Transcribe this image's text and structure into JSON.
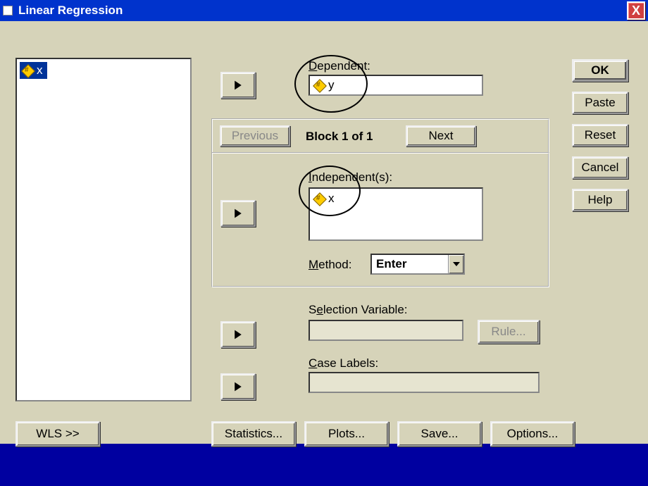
{
  "title": "Linear Regression",
  "close": "X",
  "var_listbox_item": "x",
  "dependent_label": "Dependent:",
  "dependent_value": "y",
  "previous_btn": "Previous",
  "block_text": "Block 1 of 1",
  "next_btn": "Next",
  "independent_label": "Independent(s):",
  "independent_value": "x",
  "method_label": "Method:",
  "method_value": "Enter",
  "selection_var_label": "Selection Variable:",
  "rule_btn": "Rule...",
  "case_labels_label": "Case Labels:",
  "side": {
    "ok": "OK",
    "paste": "Paste",
    "reset": "Reset",
    "cancel": "Cancel",
    "help": "Help"
  },
  "bottom": {
    "wls": "WLS >>",
    "statistics": "Statistics...",
    "plots": "Plots...",
    "save": "Save...",
    "options": "Options..."
  }
}
